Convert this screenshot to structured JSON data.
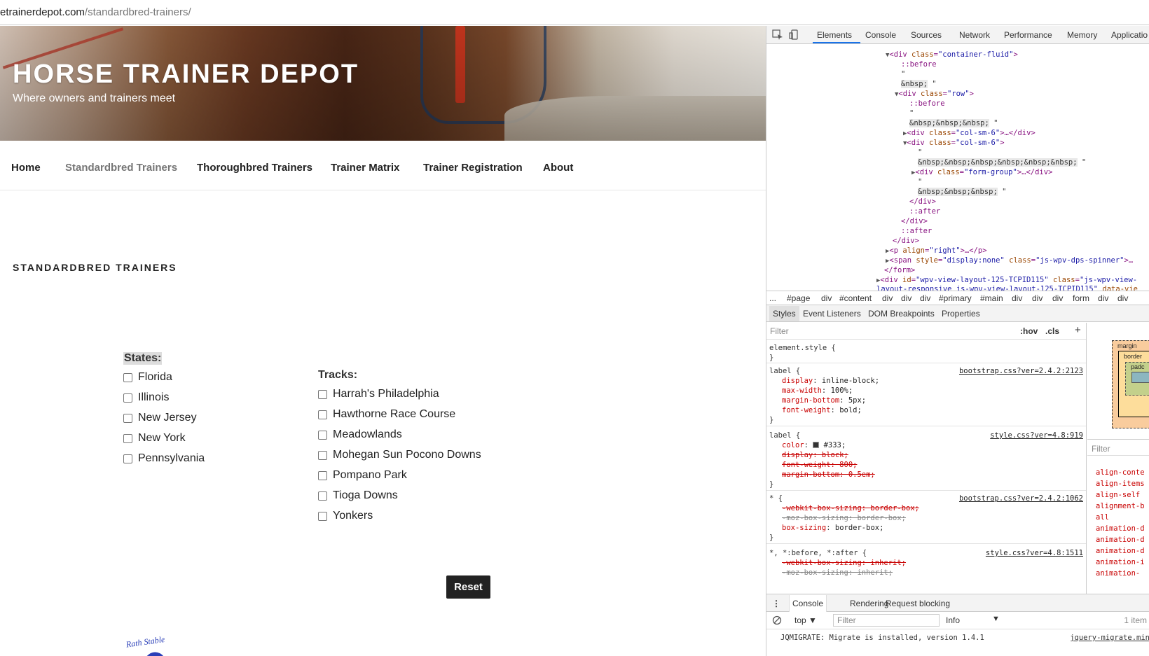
{
  "browser": {
    "url_host": "etrainerdepot.com",
    "url_path": "/standardbred-trainers/"
  },
  "site": {
    "title": "HORSE TRAINER DEPOT",
    "tagline": "Where owners and trainers meet",
    "nav": [
      "Home",
      "Standardbred Trainers",
      "Thoroughbred Trainers",
      "Trainer Matrix",
      "Trainer Registration",
      "About"
    ],
    "current_nav": "Standardbred Trainers",
    "page_title": "STANDARDBRED TRAINERS",
    "states_title": "States:",
    "states": [
      "Florida",
      "Illinois",
      "New Jersey",
      "New York",
      "Pennsylvania"
    ],
    "tracks_title": "Tracks:",
    "tracks": [
      "Harrah's Philadelphia",
      "Hawthorne Race Course",
      "Meadowlands",
      "Mohegan Sun Pocono Downs",
      "Pompano Park",
      "Tioga Downs",
      "Yonkers"
    ],
    "reset_label": "Reset",
    "logo_text": "Rath Stable"
  },
  "devtools": {
    "tabs": [
      "Elements",
      "Console",
      "Sources",
      "Network",
      "Performance",
      "Memory",
      "Applicatio"
    ],
    "active_tab": "Elements",
    "breadcrumbs": [
      "...",
      "#page",
      "div",
      "#content",
      "div",
      "div",
      "div",
      "#primary",
      "#main",
      "div",
      "div",
      "div",
      "form",
      "div",
      "div"
    ],
    "sub_tabs": [
      "Styles",
      "Event Listeners",
      "DOM Breakpoints",
      "Properties"
    ],
    "styles_filter": "Filter",
    "hov": ":hov",
    "cls": ".cls",
    "plus": "+",
    "computed_filter": "Filter",
    "computed_props": [
      "align-conte",
      "align-items",
      "align-self",
      "alignment-b",
      "all",
      "animation-d",
      "animation-d",
      "animation-d",
      "animation-i",
      "animation-"
    ],
    "box_labels": {
      "margin": "margin",
      "border": "border",
      "padding": "padc"
    },
    "drawer_tabs": [
      "Console",
      "Rendering",
      "Request blocking"
    ],
    "console_context": "top ▼",
    "console_filter": "Filter",
    "console_level": "Info",
    "console_count": "1 item",
    "console_message": "JQMIGRATE: Migrate is installed, version 1.4.1",
    "console_source": "jquery-migrate.min"
  }
}
